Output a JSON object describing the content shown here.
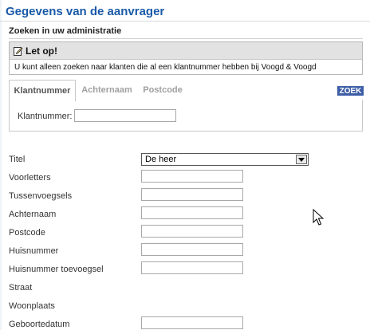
{
  "page_title": "Gegevens van de aanvrager",
  "section_heading": "Zoeken in uw administratie",
  "notice": {
    "icon": "edit-icon",
    "title": "Let op!",
    "message": "U kunt alleen zoeken naar klanten die al een klantnummer hebben bij Voogd & Voogd"
  },
  "tabs": [
    {
      "label": "Klantnummer",
      "active": true
    },
    {
      "label": "Achternaam",
      "active": false
    },
    {
      "label": "Postcode",
      "active": false
    }
  ],
  "search_button": "ZOEK",
  "klantnummer": {
    "label": "Klantnummer:",
    "value": ""
  },
  "form": {
    "titel": {
      "label": "Titel",
      "value": "De heer"
    },
    "voorletters": {
      "label": "Voorletters",
      "value": ""
    },
    "tussenvoegsels": {
      "label": "Tussenvoegsels",
      "value": ""
    },
    "achternaam": {
      "label": "Achternaam",
      "value": ""
    },
    "postcode": {
      "label": "Postcode",
      "value": ""
    },
    "huisnummer": {
      "label": "Huisnummer",
      "value": ""
    },
    "huisnummer_toevoegsel": {
      "label": "Huisnummer toevoegsel",
      "value": ""
    },
    "straat": {
      "label": "Straat"
    },
    "woonplaats": {
      "label": "Woonplaats"
    },
    "geboortedatum": {
      "label": "Geboortedatum",
      "value": ""
    }
  },
  "colors": {
    "title": "#1a5aa8",
    "search_button": "#3d5ea6",
    "notice_header": "#e2e2e2"
  }
}
